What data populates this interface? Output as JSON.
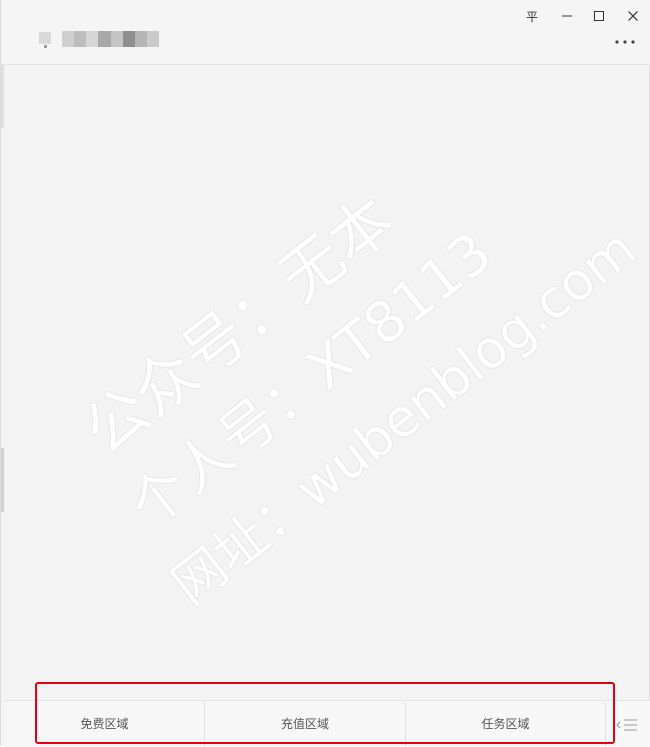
{
  "window": {
    "pin_symbol": "平",
    "minimize_symbol": "—",
    "more_symbol": "···"
  },
  "watermark": {
    "line1": "公众号：无本",
    "line2": "个人号：XT8113",
    "line3": "网址：wubenblog.com"
  },
  "bottom_tabs": [
    {
      "label": "免费区域"
    },
    {
      "label": "充值区域"
    },
    {
      "label": "任务区域"
    }
  ],
  "colors": {
    "highlight_box": "#e60012",
    "background": "#f3f3f3",
    "tab_text": "#555555"
  }
}
